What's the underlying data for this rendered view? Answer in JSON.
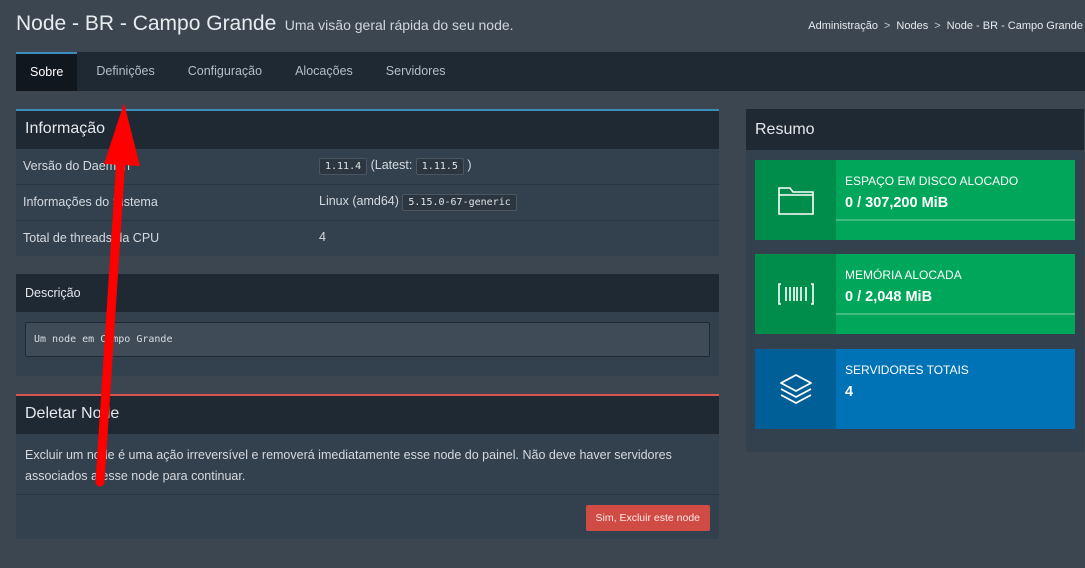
{
  "header": {
    "title": "Node - BR - Campo Grande",
    "subtitle": "Uma visão geral rápida do seu node."
  },
  "breadcrumb": [
    "Administração",
    "Nodes",
    "Node - BR - Campo Grande"
  ],
  "breadcrumb_sep": ">",
  "tabs": [
    {
      "label": "Sobre",
      "active": true
    },
    {
      "label": "Definições"
    },
    {
      "label": "Configuração"
    },
    {
      "label": "Alocações"
    },
    {
      "label": "Servidores"
    }
  ],
  "info": {
    "title": "Informação",
    "rows": [
      {
        "label": "Versão do Daemon",
        "version": "1.11.4",
        "latest_prefix": "(Latest:",
        "latest": "1.11.5",
        "latest_suffix": ")"
      },
      {
        "label": "Informações do Sistema",
        "os": "Linux (amd64)",
        "kernel": "5.15.0-67-generic"
      },
      {
        "label": "Total de threads da CPU",
        "value": "4"
      }
    ]
  },
  "description": {
    "title": "Descrição",
    "text": "Um node em Campo Grande"
  },
  "delete": {
    "title": "Deletar Node",
    "text": "Excluir um node é uma ação irreversível e removerá imediatamente esse node do painel. Não deve haver servidores associados a esse node para continuar.",
    "button": "Sim, Excluir este node",
    "accent": "#d9534f"
  },
  "summary": {
    "title": "Resumo",
    "cards": [
      {
        "label": "ESPAÇO EM DISCO ALOCADO",
        "value": "0 / 307,200 MiB",
        "icon": "folder-icon",
        "color": "#00a65a"
      },
      {
        "label": "MEMÓRIA ALOCADA",
        "value": "0 / 2,048 MiB",
        "icon": "barcode-icon",
        "color": "#00a65a"
      },
      {
        "label": "SERVIDORES TOTAIS",
        "value": "4",
        "icon": "layers-icon",
        "color": "#0073b7"
      }
    ]
  },
  "annotation": {
    "color": "#ff0000",
    "icon": "red-arrow-annotation"
  }
}
